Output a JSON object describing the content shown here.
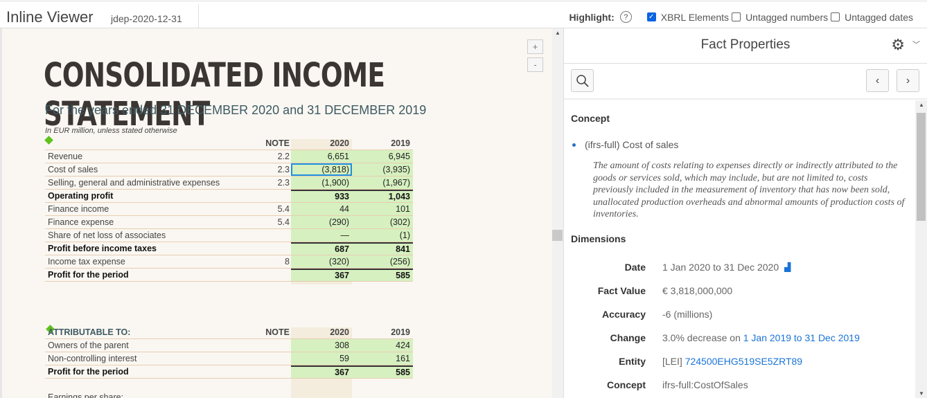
{
  "app": {
    "name": "Inline Viewer",
    "document": "jdep-2020-12-31"
  },
  "highlight": {
    "label": "Highlight:",
    "help": "?",
    "options": [
      {
        "label": "XBRL Elements",
        "checked": true
      },
      {
        "label": "Untagged numbers",
        "checked": false
      },
      {
        "label": "Untagged dates",
        "checked": false
      }
    ]
  },
  "viewer": {
    "zoom_in": "+",
    "zoom_out": "-",
    "title": "CONSOLIDATED INCOME STATEMENT",
    "subtitle": "For the years ended 31 DECEMBER 2020 and 31 DECEMBER 2019",
    "unit": "In EUR million, unless stated otherwise",
    "header": {
      "note": "NOTE",
      "y1": "2020",
      "y2": "2019"
    },
    "rows": [
      {
        "label": "Revenue",
        "note": "2.2",
        "v2020": "6,651",
        "v2019": "6,945",
        "bold": false
      },
      {
        "label": "Cost of sales",
        "note": "2.3",
        "v2020": "(3,818)",
        "v2019": "(3,935)",
        "bold": false
      },
      {
        "label": "Selling, general and administrative expenses",
        "note": "2.3",
        "v2020": "(1,900)",
        "v2019": "(1,967)",
        "bold": false
      },
      {
        "label": "Operating profit",
        "note": "",
        "v2020": "933",
        "v2019": "1,043",
        "bold": true
      },
      {
        "label": "Finance income",
        "note": "5.4",
        "v2020": "44",
        "v2019": "101",
        "bold": false
      },
      {
        "label": "Finance expense",
        "note": "5.4",
        "v2020": "(290)",
        "v2019": "(302)",
        "bold": false
      },
      {
        "label": "Share of net loss of associates",
        "note": "",
        "v2020": "—",
        "v2019": "(1)",
        "bold": false
      },
      {
        "label": "Profit before income taxes",
        "note": "",
        "v2020": "687",
        "v2019": "841",
        "bold": true
      },
      {
        "label": "Income tax expense",
        "note": "8",
        "v2020": "(320)",
        "v2019": "(256)",
        "bold": false
      },
      {
        "label": "Profit for the period",
        "note": "",
        "v2020": "367",
        "v2019": "585",
        "bold": true
      }
    ],
    "attr_header": {
      "label": "ATTRIBUTABLE TO:",
      "note": "NOTE",
      "y1": "2020",
      "y2": "2019"
    },
    "attr_rows": [
      {
        "label": "Owners of the parent",
        "note": "",
        "v2020": "308",
        "v2019": "424",
        "bold": false
      },
      {
        "label": "Non-controlling interest",
        "note": "",
        "v2020": "59",
        "v2019": "161",
        "bold": false
      },
      {
        "label": "Profit for the period",
        "note": "",
        "v2020": "367",
        "v2019": "585",
        "bold": true
      }
    ],
    "eps_label": "Earnings per share:"
  },
  "panel": {
    "title": "Fact Properties",
    "concept_heading": "Concept",
    "concept": "(ifrs-full) Cost of sales",
    "description": "The amount of costs relating to expenses directly or indirectly attributed to the goods or services sold, which may include, but are not limited to, costs previously included in the measurement of inventory that has now been sold, unallocated production overheads and abnormal amounts of production costs of inventories.",
    "dimensions_heading": "Dimensions",
    "date_label": "Date",
    "date": "1 Jan 2020 to 31 Dec 2020",
    "fact_value_label": "Fact Value",
    "fact_value": "€ 3,818,000,000",
    "accuracy_label": "Accuracy",
    "accuracy": "-6 (millions)",
    "change_label": "Change",
    "change": "3.0% decrease on",
    "change_period": "1 Jan 2019 to 31 Dec 2019",
    "entity_label": "Entity",
    "entity_scheme": "[LEI]",
    "entity_id": "724500EHG519SE5ZRT89",
    "concept_label": "Concept",
    "concept_name": "ifrs-full:CostOfSales"
  }
}
